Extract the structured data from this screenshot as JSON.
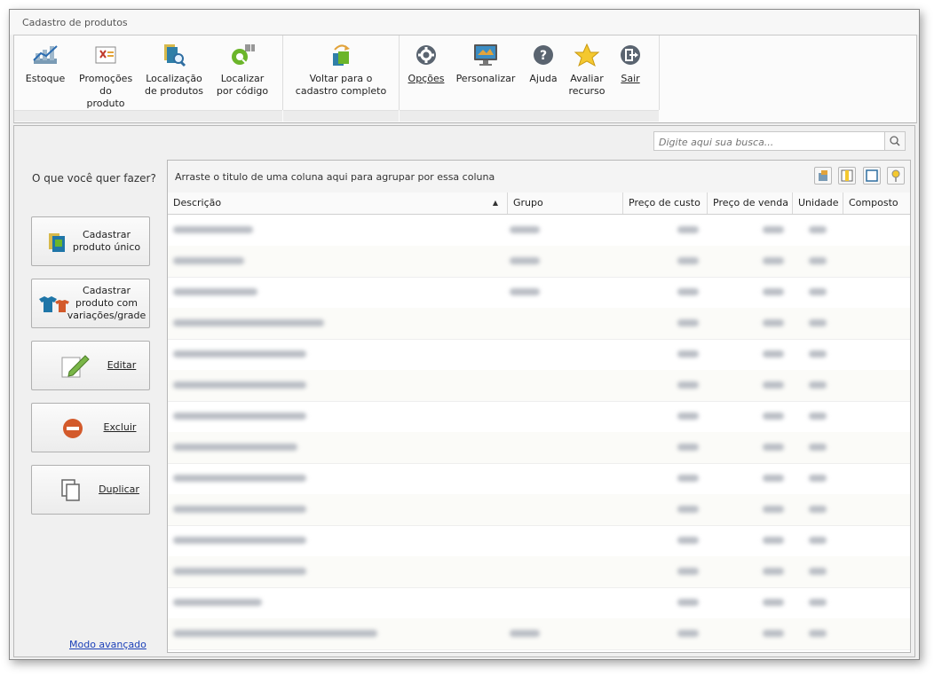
{
  "window": {
    "title": "Cadastro de produtos"
  },
  "ribbon": {
    "buttons": [
      {
        "label": "Estoque"
      },
      {
        "label": "Promoções do produto"
      },
      {
        "label": "Localização de produtos"
      },
      {
        "label": "Localizar por código"
      },
      {
        "label": "Voltar para o cadastro completo"
      },
      {
        "label": "Opções"
      },
      {
        "label": "Personalizar"
      },
      {
        "label": "Ajuda"
      },
      {
        "label": "Avaliar recurso"
      },
      {
        "label": "Sair"
      }
    ]
  },
  "search": {
    "placeholder": "Digite aqui sua busca..."
  },
  "left": {
    "title": "O que você quer fazer?",
    "actions": [
      {
        "label": "Cadastrar produto único"
      },
      {
        "label": "Cadastrar produto com variações/grade"
      },
      {
        "label": "Editar"
      },
      {
        "label": "Excluir"
      },
      {
        "label": "Duplicar"
      }
    ],
    "advanced_link": "Modo avançado"
  },
  "grid": {
    "group_hint": "Arraste o titulo de uma coluna aqui para agrupar por essa coluna",
    "columns": [
      {
        "label": "Descrição",
        "sort": "ascending"
      },
      {
        "label": "Grupo"
      },
      {
        "label": "Preço de custo"
      },
      {
        "label": "Preço de venda"
      },
      {
        "label": "Unidade"
      },
      {
        "label": "Composto"
      }
    ],
    "row_count": 14
  },
  "colors": {
    "accent_blue": "#1a3fb8",
    "row_blur": "#b9bdc4"
  }
}
